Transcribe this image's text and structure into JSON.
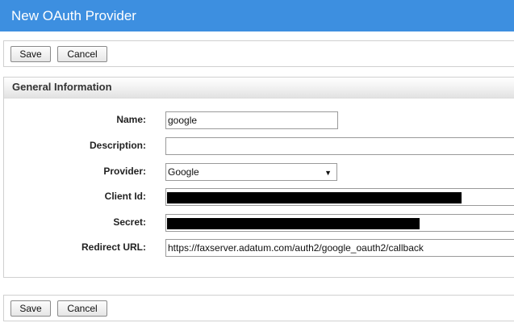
{
  "window": {
    "title": "New OAuth Provider"
  },
  "toolbar": {
    "save_label": "Save",
    "cancel_label": "Cancel"
  },
  "section": {
    "title": "General Information"
  },
  "form": {
    "name": {
      "label": "Name:",
      "value": "google"
    },
    "description": {
      "label": "Description:",
      "value": ""
    },
    "provider": {
      "label": "Provider:",
      "value": "Google"
    },
    "client_id": {
      "label": "Client Id:",
      "value": ""
    },
    "secret": {
      "label": "Secret:",
      "value": ""
    },
    "redirect_url": {
      "label": "Redirect URL:",
      "value": "https://faxserver.adatum.com/auth2/google_oauth2/callback"
    }
  },
  "colors": {
    "titlebar": "#3d8fe0"
  }
}
